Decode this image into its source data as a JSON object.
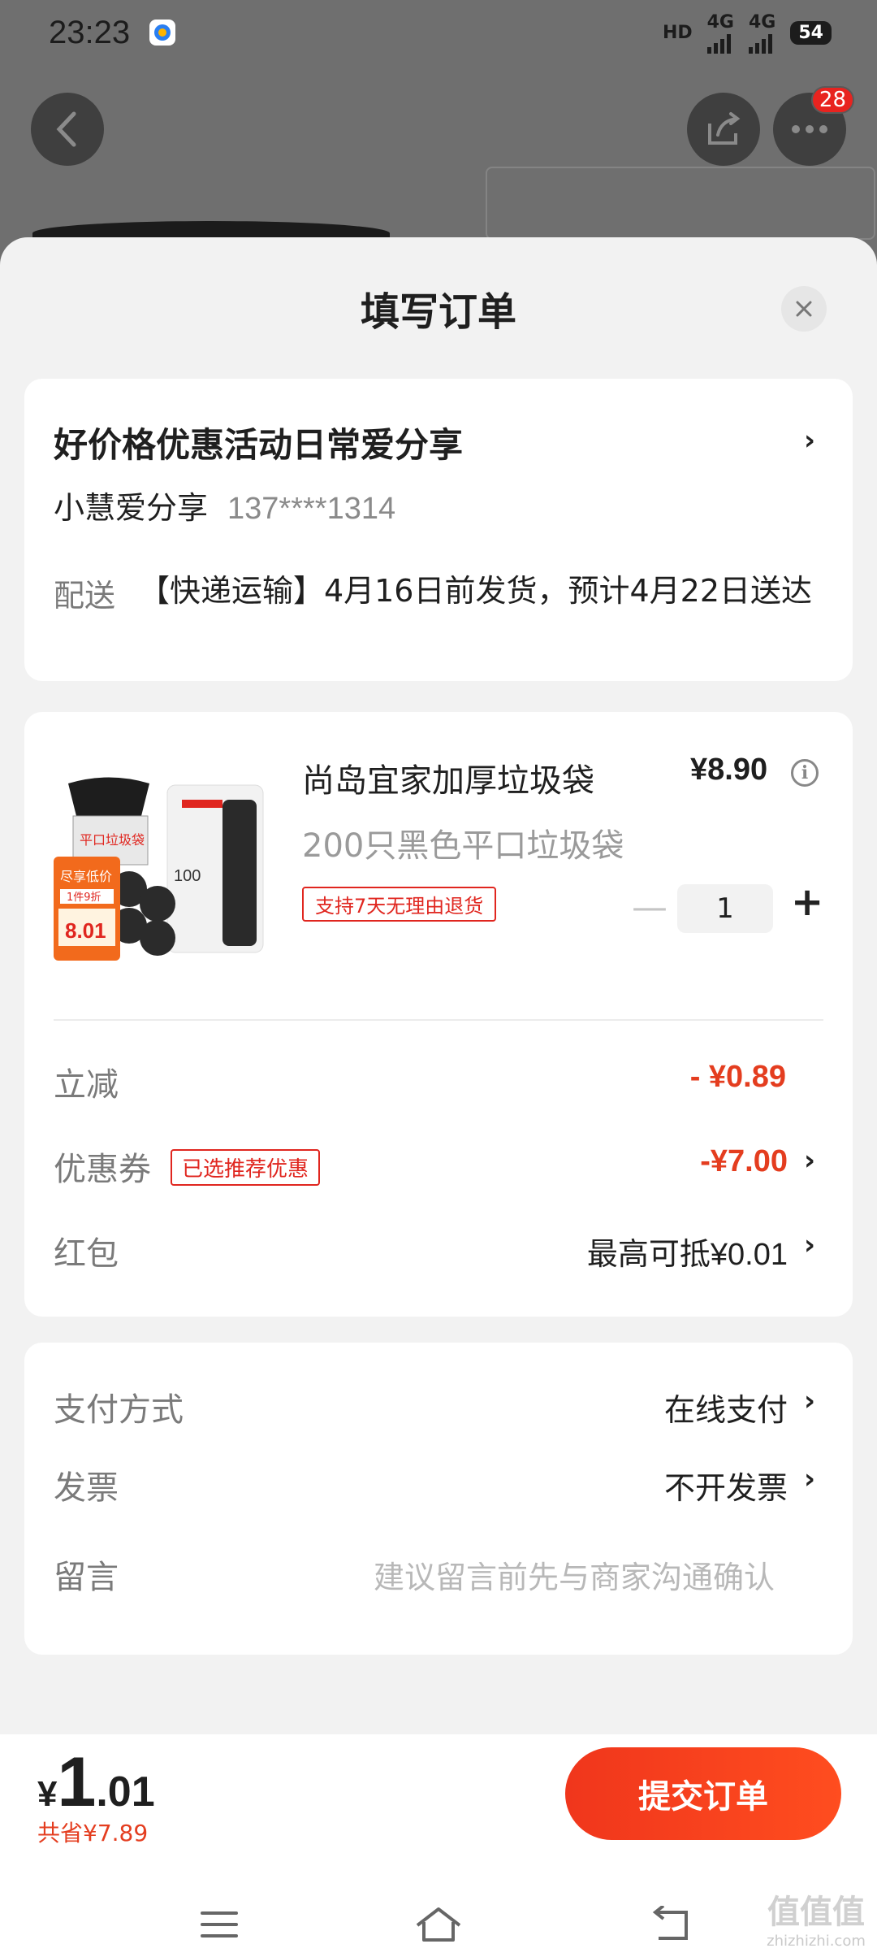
{
  "status_bar": {
    "time": "23:23",
    "hd_label": "HD",
    "net1": "4G",
    "net2": "4G",
    "battery": "54"
  },
  "header": {
    "back_icon": "chevron-left-icon",
    "share_icon": "share-icon",
    "more_icon": "more-dots-icon",
    "more_badge": "28"
  },
  "sheet": {
    "title": "填写订单",
    "close_icon": "close-icon"
  },
  "address": {
    "name": "好价格优惠活动日常爱分享",
    "contact_name": "小慧爱分享",
    "phone": "137****1314",
    "shipping_label": "配送",
    "shipping_text": "【快递运输】4月16日前发货，预计4月22日送达"
  },
  "product": {
    "title": "尚岛宜家加厚垃圾袋",
    "price": "¥8.90",
    "spec": "200只黑色平口垃圾袋",
    "return_tag": "支持7天无理由退货",
    "quantity": "1",
    "image_text": {
      "label": "平口垃圾袋",
      "promo": "尽享低价",
      "discount": "1件9折",
      "price": "8.01",
      "count": "100"
    }
  },
  "discounts": {
    "instant_label": "立减",
    "instant_value": "- ¥0.89",
    "coupon_label": "优惠券",
    "coupon_tag": "已选推荐优惠",
    "coupon_value": "-¥7.00",
    "redpacket_label": "红包",
    "redpacket_value": "最高可抵¥0.01"
  },
  "payment": {
    "method_label": "支付方式",
    "method_value": "在线支付",
    "invoice_label": "发票",
    "invoice_value": "不开发票",
    "message_label": "留言",
    "message_placeholder": "建议留言前先与商家沟通确认"
  },
  "footer": {
    "currency": "¥",
    "total_int": "1",
    "total_dec": ".01",
    "saved": "共省¥7.89",
    "submit": "提交订单"
  },
  "nav": {
    "menu_icon": "menu-icon",
    "home_icon": "home-icon",
    "back_icon": "back-icon"
  },
  "watermark": {
    "brand": "值值值",
    "site": "zhizhizhi.com"
  },
  "colors": {
    "accent": "#f0361c",
    "price_red": "#e43d1f",
    "background": "#f2f2f2"
  }
}
